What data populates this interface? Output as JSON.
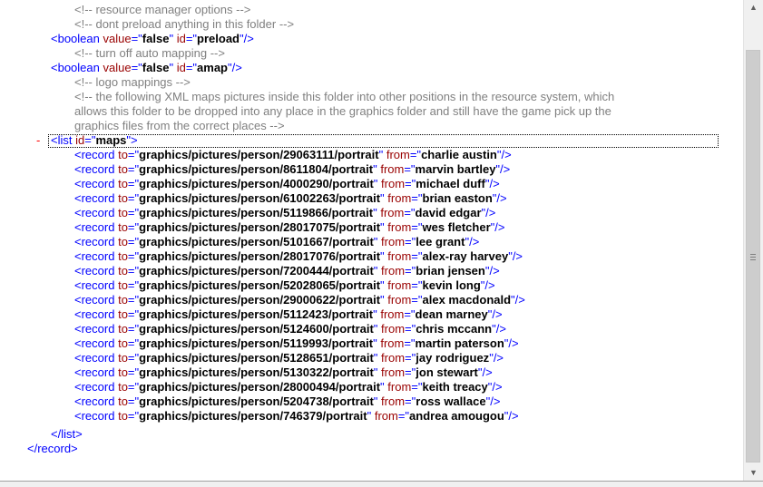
{
  "lines_top": [
    {
      "text": "<!-- resource manager options -->"
    },
    {
      "text": "<!-- dont preload anything in this folder -->"
    }
  ],
  "boolean1": {
    "tag_open": "<boolean",
    "attr1": "value",
    "val1": "false",
    "attr2": "id",
    "val2": "preload",
    "tag_close": "/>"
  },
  "comment3": "<!-- turn off auto mapping -->",
  "boolean2": {
    "tag_open": "<boolean",
    "attr1": "value",
    "val1": "false",
    "attr2": "id",
    "val2": "amap",
    "tag_close": "/>"
  },
  "comment4": "<!-- logo mappings -->",
  "comment5": [
    "<!-- the following XML maps pictures inside this folder into other positions in the resource system, which",
    "allows this folder to be dropped into any place in the graphics folder and still have the game pick up the",
    "graphics files from the correct places -->"
  ],
  "list": {
    "minus": "-",
    "tag_open": "<list",
    "attr": "id",
    "val": "maps",
    "tag_close": ">"
  },
  "record_labels": {
    "tag_open": "<record",
    "attr_to": "to",
    "attr_from": "from",
    "tag_close": "/>"
  },
  "records": [
    {
      "to": "graphics/pictures/person/29063111/portrait",
      "from": "charlie austin"
    },
    {
      "to": "graphics/pictures/person/8611804/portrait",
      "from": "marvin bartley"
    },
    {
      "to": "graphics/pictures/person/4000290/portrait",
      "from": "michael duff"
    },
    {
      "to": "graphics/pictures/person/61002263/portrait",
      "from": "brian easton"
    },
    {
      "to": "graphics/pictures/person/5119866/portrait",
      "from": "david edgar"
    },
    {
      "to": "graphics/pictures/person/28017075/portrait",
      "from": "wes fletcher"
    },
    {
      "to": "graphics/pictures/person/5101667/portrait",
      "from": "lee grant"
    },
    {
      "to": "graphics/pictures/person/28017076/portrait",
      "from": "alex-ray harvey"
    },
    {
      "to": "graphics/pictures/person/7200444/portrait",
      "from": "brian jensen"
    },
    {
      "to": "graphics/pictures/person/52028065/portrait",
      "from": "kevin long"
    },
    {
      "to": "graphics/pictures/person/29000622/portrait",
      "from": "alex macdonald"
    },
    {
      "to": "graphics/pictures/person/5112423/portrait",
      "from": "dean marney"
    },
    {
      "to": "graphics/pictures/person/5124600/portrait",
      "from": "chris mccann"
    },
    {
      "to": "graphics/pictures/person/5119993/portrait",
      "from": "martin paterson"
    },
    {
      "to": "graphics/pictures/person/5128651/portrait",
      "from": "jay rodriguez"
    },
    {
      "to": "graphics/pictures/person/5130322/portrait",
      "from": "jon stewart"
    },
    {
      "to": "graphics/pictures/person/28000494/portrait",
      "from": "keith treacy"
    },
    {
      "to": "graphics/pictures/person/5204738/portrait",
      "from": "ross wallace"
    },
    {
      "to": "graphics/pictures/person/746379/portrait",
      "from": "andrea amougou"
    }
  ],
  "list_close": "</list>",
  "record_close": "</record>",
  "scrollbar": {
    "up_icon": "up-arrow-icon",
    "down_icon": "down-arrow-icon",
    "position": 0.1
  }
}
